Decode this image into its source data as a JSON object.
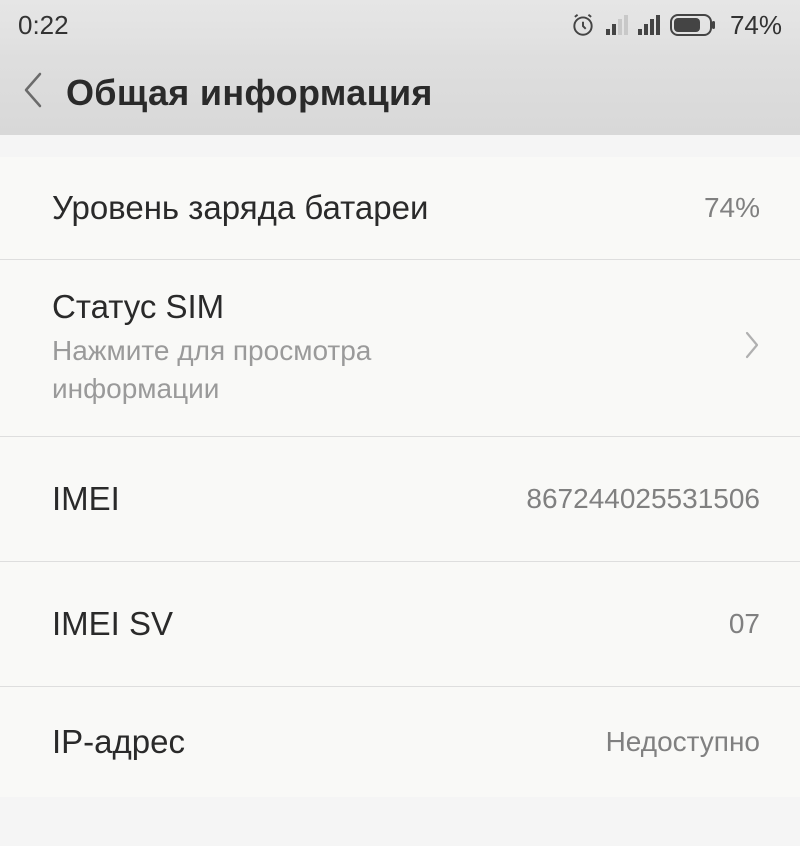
{
  "status": {
    "time": "0:22",
    "battery_percent": "74%"
  },
  "header": {
    "title": "Общая информация"
  },
  "rows": {
    "battery": {
      "label": "Уровень заряда батареи",
      "value": "74%"
    },
    "sim": {
      "label": "Статус SIM",
      "subtitle": "Нажмите для просмотра информации"
    },
    "imei": {
      "label": "IMEI",
      "value": "867244025531506"
    },
    "imei_sv": {
      "label": "IMEI SV",
      "value": "07"
    },
    "ip": {
      "label": "IP-адрес",
      "value": "Недоступно"
    }
  }
}
